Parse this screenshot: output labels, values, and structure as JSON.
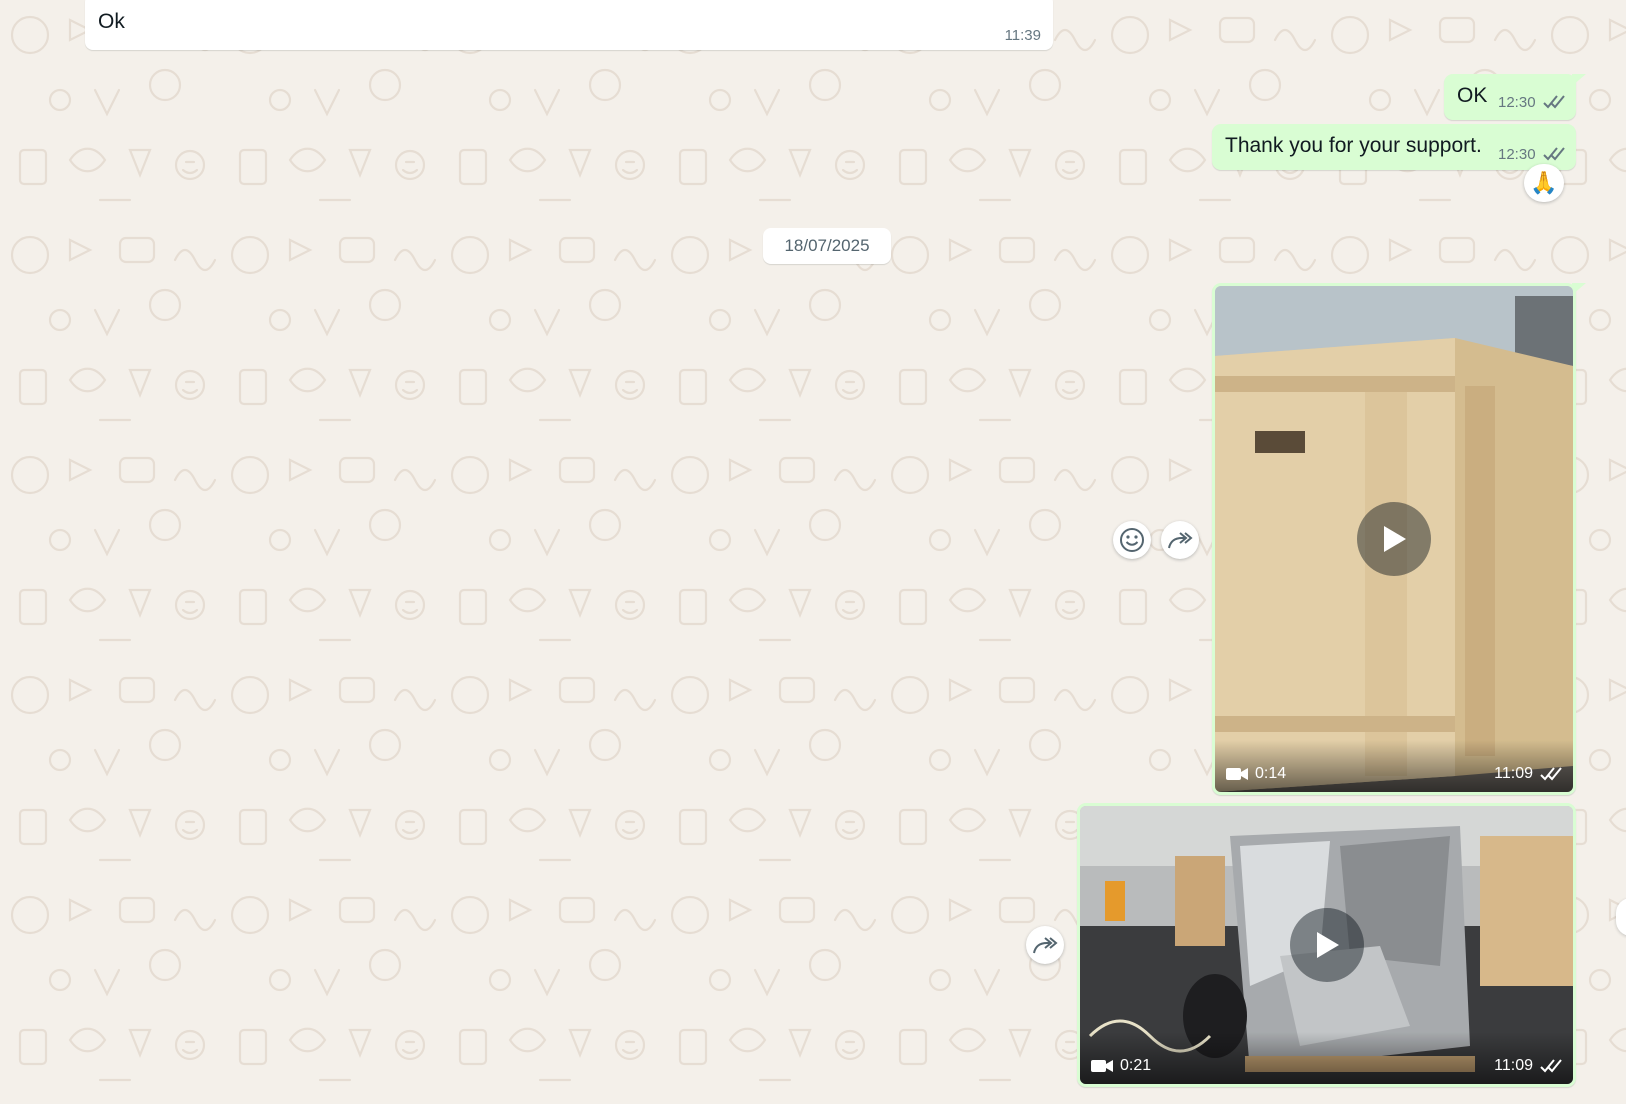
{
  "theme": {
    "chat_bg": "#f4f0ea",
    "bubble_in": "#ffffff",
    "bubble_out": "#d9fdd3",
    "read_tick": "#667781",
    "meta_text": "#667781"
  },
  "messages": [
    {
      "direction": "incoming",
      "text": "Ok",
      "time": "11:39"
    },
    {
      "direction": "outgoing",
      "text": "OK",
      "time": "12:30",
      "status_icon": "double-check-icon"
    },
    {
      "direction": "outgoing",
      "text": "Thank you for your support.",
      "time": "12:30",
      "status_icon": "double-check-icon",
      "reaction": "🙏"
    }
  ],
  "date_separator": "18/07/2025",
  "videos": [
    {
      "duration": "0:14",
      "time": "11:09",
      "status_icon": "double-check-icon",
      "icon": "video-camera-icon"
    },
    {
      "duration": "0:21",
      "time": "11:09",
      "status_icon": "double-check-icon",
      "icon": "video-camera-icon"
    }
  ],
  "hover_actions": {
    "react_icon": "smiley-icon",
    "forward_icon": "forward-icon"
  }
}
